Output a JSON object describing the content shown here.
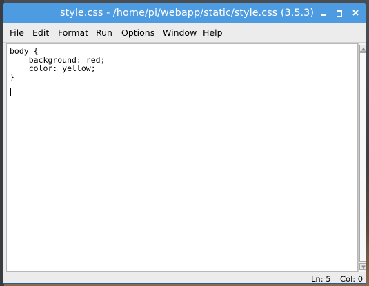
{
  "window": {
    "title": "style.css - /home/pi/webapp/static/style.css (3.5.3)",
    "controls": {
      "minimize": "minimize-icon",
      "maximize": "maximize-icon",
      "close": "close-icon"
    },
    "titlebar_color": "#4d9be0"
  },
  "menu": {
    "items": [
      {
        "mnemonic": "F",
        "rest": "ile"
      },
      {
        "mnemonic": "E",
        "rest": "dit"
      },
      {
        "pre": "F",
        "mnemonic": "o",
        "rest": "rmat"
      },
      {
        "mnemonic": "R",
        "rest": "un"
      },
      {
        "mnemonic": "O",
        "rest": "ptions"
      },
      {
        "mnemonic": "W",
        "rest": "indow"
      },
      {
        "mnemonic": "H",
        "rest": "elp"
      }
    ]
  },
  "editor": {
    "code_lines": [
      "body {",
      "    background: red;",
      "    color: yellow;",
      "}",
      ""
    ]
  },
  "status": {
    "line": "Ln: 5",
    "column": "Col: 0"
  }
}
